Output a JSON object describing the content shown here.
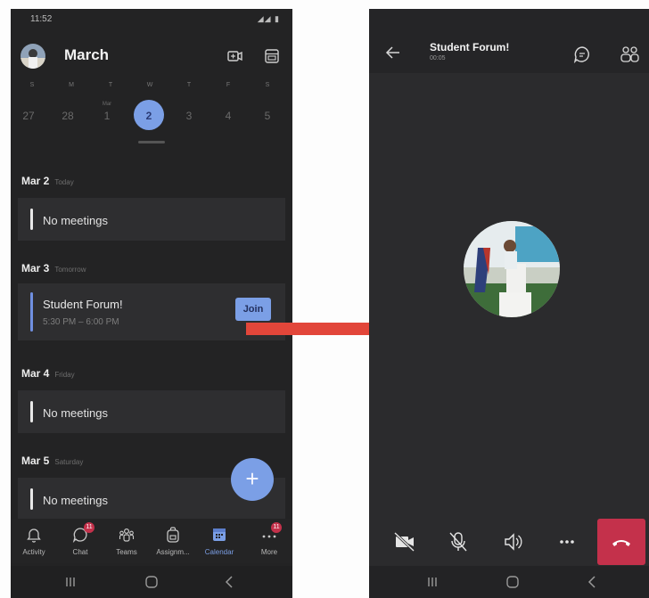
{
  "left_screen": {
    "status_time": "11:52",
    "status_icons": "◢◢ ▮",
    "month_title": "March",
    "weekdays": [
      "S",
      "M",
      "T",
      "W",
      "T",
      "F",
      "S"
    ],
    "dates": [
      {
        "num": "27",
        "month": ""
      },
      {
        "num": "28",
        "month": ""
      },
      {
        "num": "1",
        "month": "Mar"
      },
      {
        "num": "2",
        "month": "",
        "selected": true
      },
      {
        "num": "3",
        "month": ""
      },
      {
        "num": "4",
        "month": ""
      },
      {
        "num": "5",
        "month": ""
      }
    ],
    "agenda": [
      {
        "date": "Mar 2",
        "sub": "Today",
        "item": "No meetings"
      },
      {
        "date": "Mar 3",
        "sub": "Tomorrow",
        "event_title": "Student Forum!",
        "event_time": "5:30 PM – 6:00 PM",
        "join_label": "Join"
      },
      {
        "date": "Mar 4",
        "sub": "Friday",
        "item": "No meetings"
      },
      {
        "date": "Mar 5",
        "sub": "Saturday",
        "item": "No meetings"
      }
    ],
    "fab_label": "+",
    "tabs": [
      {
        "label": "Activity",
        "icon": "bell-icon"
      },
      {
        "label": "Chat",
        "icon": "chat-icon",
        "badge": "11"
      },
      {
        "label": "Teams",
        "icon": "teams-icon"
      },
      {
        "label": "Assignm...",
        "icon": "backpack-icon"
      },
      {
        "label": "Calendar",
        "icon": "calendar-icon",
        "active": true
      },
      {
        "label": "More",
        "icon": "more-icon",
        "badge": "11"
      }
    ],
    "accent_color": "#7b9fe6",
    "badge_color": "#c4314b"
  },
  "right_screen": {
    "call_title": "Student Forum!",
    "call_timer": "00:05",
    "hangup_color": "#c4314b"
  },
  "arrow_color": "#e2463a"
}
